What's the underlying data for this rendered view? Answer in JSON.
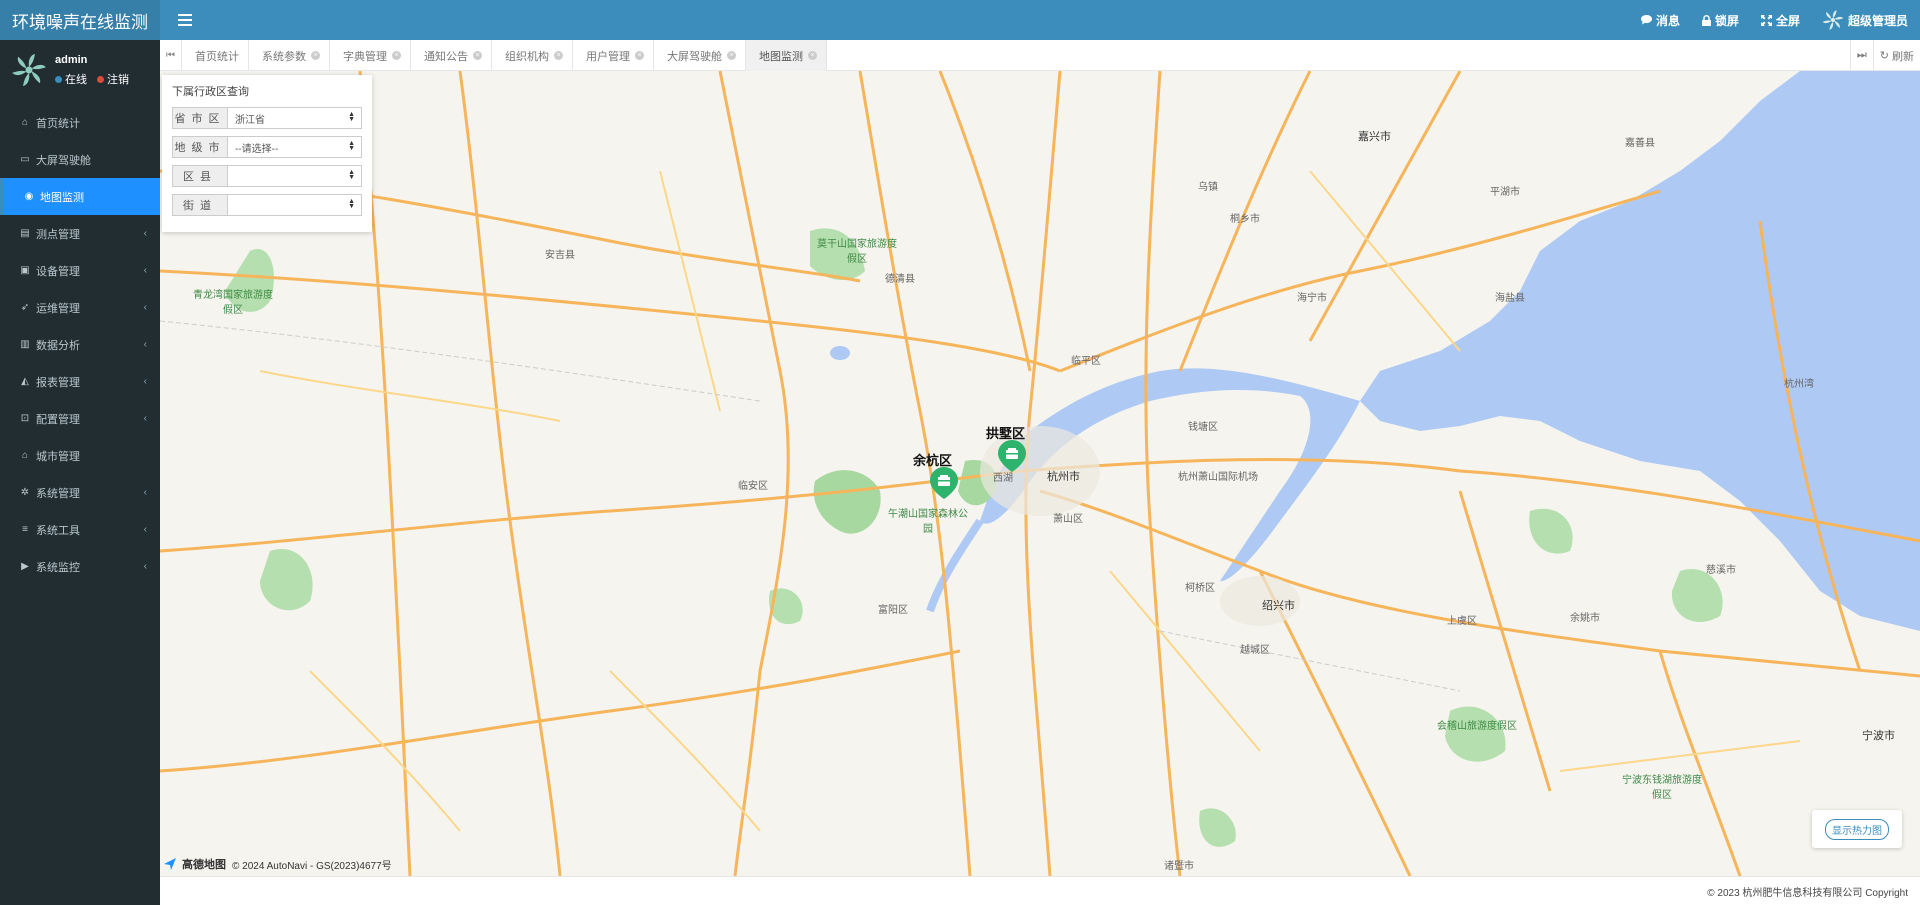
{
  "app": {
    "title": "环境噪声在线监测"
  },
  "header": {
    "actions": [
      {
        "key": "msg",
        "label": "消息",
        "icon": "comment-icon"
      },
      {
        "key": "lock",
        "label": "锁屏",
        "icon": "lock-icon"
      },
      {
        "key": "full",
        "label": "全屏",
        "icon": "expand-icon"
      },
      {
        "key": "user",
        "label": "超级管理员",
        "icon": "fan-avatar-icon"
      }
    ]
  },
  "user": {
    "name": "admin",
    "status": "在线",
    "logout": "注销",
    "status_color": "#3c8dbc",
    "logout_color": "#dd4b39"
  },
  "sidebar": {
    "items": [
      {
        "label": "首页统计",
        "icon": "home-icon",
        "caret": false,
        "active": false
      },
      {
        "label": "大屏驾驶舱",
        "icon": "window-icon",
        "caret": false,
        "active": false
      },
      {
        "label": "地图监测",
        "icon": "globe-icon",
        "caret": false,
        "active": true
      },
      {
        "label": "测点管理",
        "icon": "id-card-icon",
        "caret": true,
        "active": false
      },
      {
        "label": "设备管理",
        "icon": "briefcase-icon",
        "caret": true,
        "active": false
      },
      {
        "label": "运维管理",
        "icon": "rocket-icon",
        "caret": true,
        "active": false
      },
      {
        "label": "数据分析",
        "icon": "bar-chart-icon",
        "caret": true,
        "active": false
      },
      {
        "label": "报表管理",
        "icon": "area-chart-icon",
        "caret": true,
        "active": false
      },
      {
        "label": "配置管理",
        "icon": "unlock-icon",
        "caret": true,
        "active": false
      },
      {
        "label": "城市管理",
        "icon": "bank-icon",
        "caret": false,
        "active": false
      },
      {
        "label": "系统管理",
        "icon": "cog-icon",
        "caret": true,
        "active": false
      },
      {
        "label": "系统工具",
        "icon": "bars-icon",
        "caret": true,
        "active": false
      },
      {
        "label": "系统监控",
        "icon": "video-icon",
        "caret": true,
        "active": false
      }
    ]
  },
  "tabs": {
    "items": [
      {
        "label": "首页统计",
        "closable": false,
        "active": false
      },
      {
        "label": "系统参数",
        "closable": true,
        "active": false
      },
      {
        "label": "字典管理",
        "closable": true,
        "active": false
      },
      {
        "label": "通知公告",
        "closable": true,
        "active": false
      },
      {
        "label": "组织机构",
        "closable": true,
        "active": false
      },
      {
        "label": "用户管理",
        "closable": true,
        "active": false
      },
      {
        "label": "大屏驾驶舱",
        "closable": true,
        "active": false
      },
      {
        "label": "地图监测",
        "closable": true,
        "active": true
      }
    ],
    "refresh_label": "刷新"
  },
  "query": {
    "title": "下属行政区查询",
    "fields": [
      {
        "label": "省市区",
        "value": "浙江省"
      },
      {
        "label": "地级市",
        "value": "--请选择--"
      },
      {
        "label": "区县",
        "value": ""
      },
      {
        "label": "街道",
        "value": ""
      }
    ]
  },
  "map": {
    "markers": [
      {
        "label": "余杭区",
        "icon": "monitor-station-icon"
      },
      {
        "label": "拱墅区",
        "icon": "monitor-station-icon"
      }
    ],
    "labels": {
      "hangzhou": "杭州市",
      "jiaxing": "嘉兴市",
      "shaoxing": "绍兴市",
      "ningbo": "宁波市",
      "airport": "杭州萧山国际机场",
      "xihu": "西湖",
      "linping": "临平区",
      "haining": "海宁市",
      "tongxiang": "桐乡市",
      "deqing": "德清县",
      "anji": "安吉县",
      "linan": "临安区",
      "fuyang": "富阳区",
      "qiantang": "钱塘区",
      "xiaoshan": "萧山区",
      "keqiao": "柯桥区",
      "shangyu": "上虞区",
      "yuecheng": "越城区",
      "cixi": "慈溪市",
      "yuyao": "余姚市",
      "haiyan": "海盐县",
      "pinghu": "平湖市",
      "jiaxingwan": "杭州湾",
      "mogan": "莫干山国家旅游度假区",
      "qinglong": "青龙湾国家旅游度假区",
      "sanjia": "午潮山国家森林公园",
      "kuaiji": "会稽山旅游度假区",
      "dongqian": "宁波东钱湖旅游度假区",
      "wuzhen": "乌镇",
      "jiashan": "嘉善县",
      "zhuji": "诸暨市"
    },
    "heatmap_button": "显示热力图",
    "credit_brand": "高德地图",
    "credit_text": "© 2024 AutoNavi - GS(2023)4677号"
  },
  "footer": {
    "copyright": "© 2023 杭州肥牛信息科技有限公司 Copyright"
  }
}
